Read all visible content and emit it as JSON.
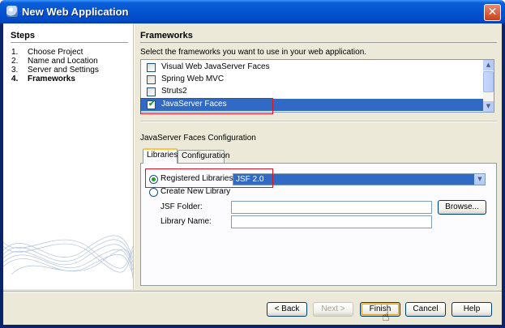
{
  "window": {
    "title": "New Web Application",
    "close_glyph": "✕"
  },
  "steps": {
    "title": "Steps",
    "items": [
      {
        "num": "1.",
        "label": "Choose Project"
      },
      {
        "num": "2.",
        "label": "Name and Location"
      },
      {
        "num": "3.",
        "label": "Server and Settings"
      },
      {
        "num": "4.",
        "label": "Frameworks",
        "current": true
      }
    ]
  },
  "frameworks": {
    "title": "Frameworks",
    "description": "Select the frameworks you want to use in your web application.",
    "items": [
      {
        "label": "Visual Web JavaServer Faces",
        "checked": false
      },
      {
        "label": "Spring Web MVC",
        "checked": false
      },
      {
        "label": "Struts2",
        "checked": false
      },
      {
        "label": "JavaServer Faces",
        "checked": true,
        "selected": true
      }
    ]
  },
  "config": {
    "title": "JavaServer Faces Configuration",
    "tabs": [
      {
        "label": "Libraries",
        "active": true
      },
      {
        "label": "Configuration",
        "active": false
      }
    ],
    "registered_label": "Registered Libraries:",
    "registered_value": "JSF 2.0",
    "create_label": "Create New Library",
    "jsf_folder_label": "JSF Folder:",
    "jsf_folder_value": "",
    "library_name_label": "Library Name:",
    "library_name_value": "",
    "browse_label": "Browse..."
  },
  "footer": {
    "back_label": "< Back",
    "next_label": "Next >",
    "finish_label": "Finish",
    "cancel_label": "Cancel",
    "help_label": "Help"
  },
  "colors": {
    "selection": "#316ac5",
    "highlight_box": "#e0141e",
    "titlebar": "#0553d1"
  }
}
